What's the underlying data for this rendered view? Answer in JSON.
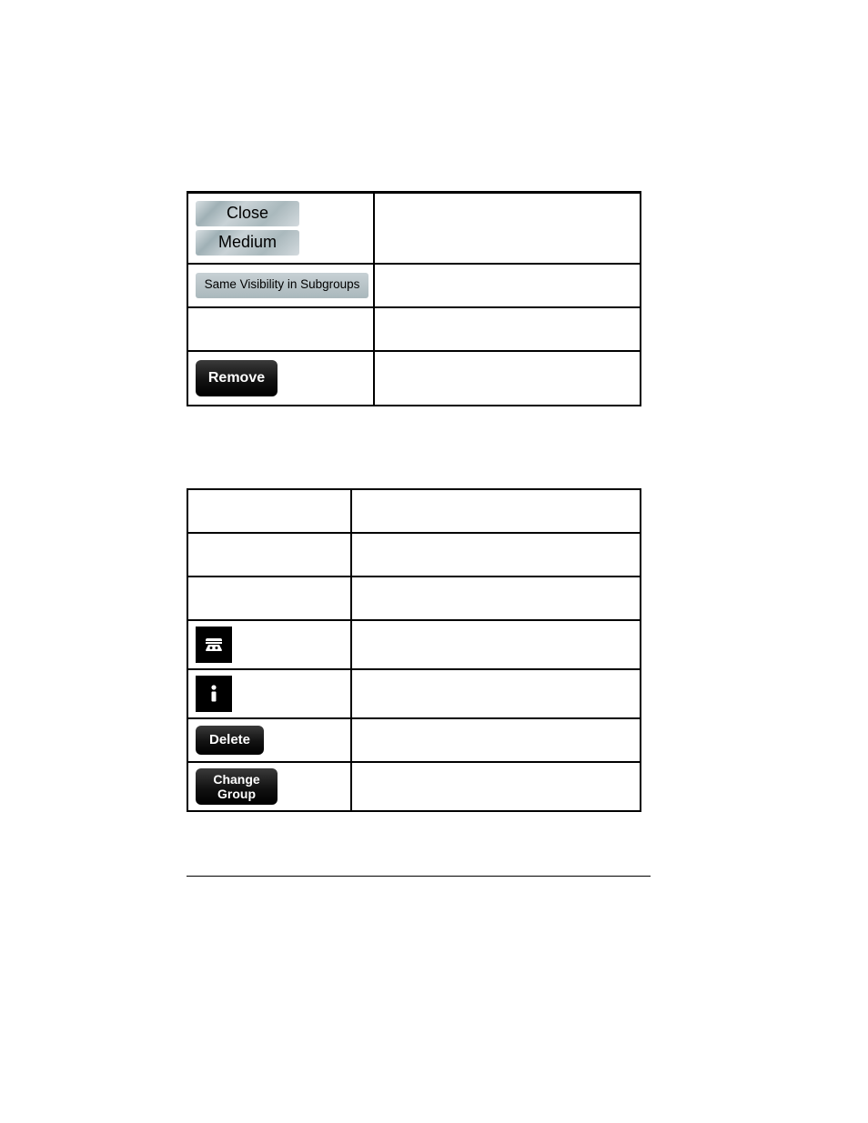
{
  "table1": {
    "rows": [
      {
        "btns": [
          "Close",
          "Medium"
        ],
        "desc": ""
      },
      {
        "btnsWide": "Same Visibility in Subgroups",
        "desc": ""
      },
      {
        "desc": ""
      },
      {
        "dark": "Remove",
        "desc": ""
      }
    ]
  },
  "table2": {
    "rows": [
      {
        "desc": ""
      },
      {
        "desc": ""
      },
      {
        "desc": ""
      },
      {
        "icon": "phone",
        "desc": ""
      },
      {
        "icon": "info",
        "desc": ""
      },
      {
        "darkSmall": "Delete",
        "desc": ""
      },
      {
        "darkTwoLine1": "Change",
        "darkTwoLine2": "Group",
        "desc": ""
      }
    ]
  }
}
